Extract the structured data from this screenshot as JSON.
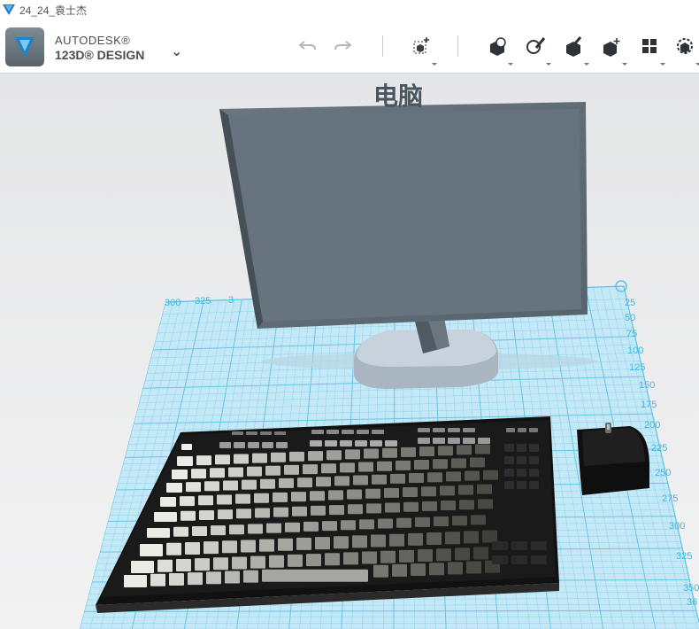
{
  "window": {
    "title": "24_24_袁士杰"
  },
  "brand": {
    "line1": "AUTODESK®",
    "line2": "123D® DESIGN"
  },
  "toolbar": {
    "undo_icon": "undo-arrow",
    "redo_icon": "redo-arrow",
    "tools": [
      "transform",
      "primitives",
      "sketch",
      "construct",
      "modify",
      "pattern",
      "group"
    ]
  },
  "viewport": {
    "text_label": "电脑",
    "grid_labels_right": [
      "25",
      "50",
      "75",
      "100",
      "125",
      "150",
      "175",
      "200",
      "225",
      "250",
      "275",
      "300",
      "325",
      "350",
      "36"
    ],
    "grid_labels_top": [
      "300",
      "325",
      "3"
    ],
    "colors": {
      "grid_line": "#5cc2e8",
      "grid_bg": "#c5e8f6",
      "monitor": "#5e6a74",
      "keyboard": "#161616"
    }
  }
}
